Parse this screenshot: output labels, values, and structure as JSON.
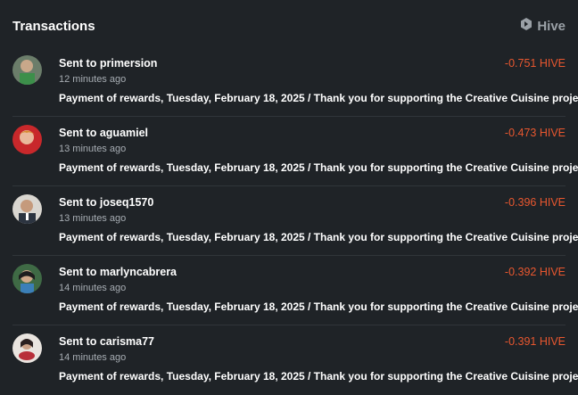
{
  "header": {
    "title": "Transactions",
    "brand": "Hive",
    "brand_icon": "hive-logo-icon"
  },
  "colors": {
    "background": "#1f2327",
    "amount_negative": "#e8572f",
    "divider": "#30353a"
  },
  "transactions": [
    {
      "prefix": "Sent to",
      "user": "primersion",
      "time": "12 minutes ago",
      "amount": "-0.751 HIVE",
      "memo": "Payment of rewards, Tuesday, February 18, 2025 / Thank you for supporting the Creative Cuisine project."
    },
    {
      "prefix": "Sent to",
      "user": "aguamiel",
      "time": "13 minutes ago",
      "amount": "-0.473 HIVE",
      "memo": "Payment of rewards, Tuesday, February 18, 2025 / Thank you for supporting the Creative Cuisine project."
    },
    {
      "prefix": "Sent to",
      "user": "joseq1570",
      "time": "13 minutes ago",
      "amount": "-0.396 HIVE",
      "memo": "Payment of rewards, Tuesday, February 18, 2025 / Thank you for supporting the Creative Cuisine project."
    },
    {
      "prefix": "Sent to",
      "user": "marlyncabrera",
      "time": "14 minutes ago",
      "amount": "-0.392 HIVE",
      "memo": "Payment of rewards, Tuesday, February 18, 2025 / Thank you for supporting the Creative Cuisine project."
    },
    {
      "prefix": "Sent to",
      "user": "carisma77",
      "time": "14 minutes ago",
      "amount": "-0.391 HIVE",
      "memo": "Payment of rewards, Tuesday, February 18, 2025 / Thank you for supporting the Creative Cuisine project."
    }
  ]
}
